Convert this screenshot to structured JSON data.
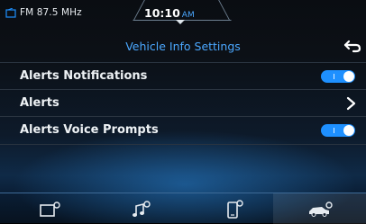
{
  "status_bar": {
    "source_label": "FM 87.5 MHz",
    "time": "10:10",
    "ampm": "AM"
  },
  "header": {
    "title": "Vehicle Info Settings"
  },
  "settings": [
    {
      "label": "Alerts Notifications",
      "control": "toggle",
      "on": true
    },
    {
      "label": "Alerts",
      "control": "arrow"
    },
    {
      "label": "Alerts Voice Prompts",
      "control": "toggle",
      "on": true
    }
  ],
  "bottom_nav": {
    "tabs": [
      {
        "icon": "screen-settings-icon",
        "active": false
      },
      {
        "icon": "sound-settings-icon",
        "active": false
      },
      {
        "icon": "phone-settings-icon",
        "active": false
      },
      {
        "icon": "vehicle-settings-icon",
        "active": true
      }
    ]
  },
  "colors": {
    "accent": "#1e90ff",
    "title": "#4ba8ff",
    "background": "#0a0d12"
  }
}
